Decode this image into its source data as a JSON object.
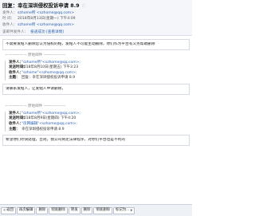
{
  "header": {
    "subject": "回复：幸在深圳侵权投诉申请 8.9",
    "sender_label": "发件人：",
    "sender_value": "szhome所 <szhome@qq.com>",
    "time_label": "时 间：",
    "time_value": "2018年8月13日(星期一) 下午4:09",
    "recipient_label": "收件人：",
    "recipient_value": "szhome所 <szhome@qq.com>",
    "security_text": "该邮件发件人：",
    "security_action": "投递成功 [查看详情]"
  },
  "body": {
    "note1": "不需要发帖人删除您认为侵权的帖，发帖人不可能主动删除，你们作为平台有义务帮助删除",
    "divider1": "—————— 原始邮件 ——————",
    "quote1": [
      {
        "label": "发件人：",
        "value": "\"szhome所\"<szhome@qq.com>;"
      },
      {
        "label": "发送时间：",
        "value": "2018年8月10日(星期五) 下午3:23"
      },
      {
        "label": "收件人：",
        "value": "\"szhome\"<szhome@qq.com>;"
      },
      {
        "label": "主题：",
        "value": "回复：幸在深圳侵权投诉申请 8.9"
      }
    ],
    "note2": "请联系发帖人，让发帖人申请删除。",
    "divider2": "—————— 原始邮件 ——————",
    "quote2": [
      {
        "label": "发件人：",
        "value": "\"szhome所\"<szhome@qq.com>;"
      },
      {
        "label": "发送时间：",
        "value": "2018年8月9日(星期四) 下午4:20"
      },
      {
        "label": "收件人：",
        "value": "\"房网编辑\"<szhome@qq.com>;"
      },
      {
        "label": "主题：",
        "value": "幸在深圳侵权投诉申请 8.9"
      }
    ],
    "note3": "希望你们尽快处理，否则，我公司将走法律程序，对你们平台也是不利的"
  },
  "toolbar": {
    "back": "返回",
    "reply_all": "再次编辑",
    "delete": "删除",
    "complete_delete": "彻底删除",
    "forward": "转发",
    "mark_as": "删除",
    "move_to": "彻底删除",
    "more": "标记为..."
  }
}
